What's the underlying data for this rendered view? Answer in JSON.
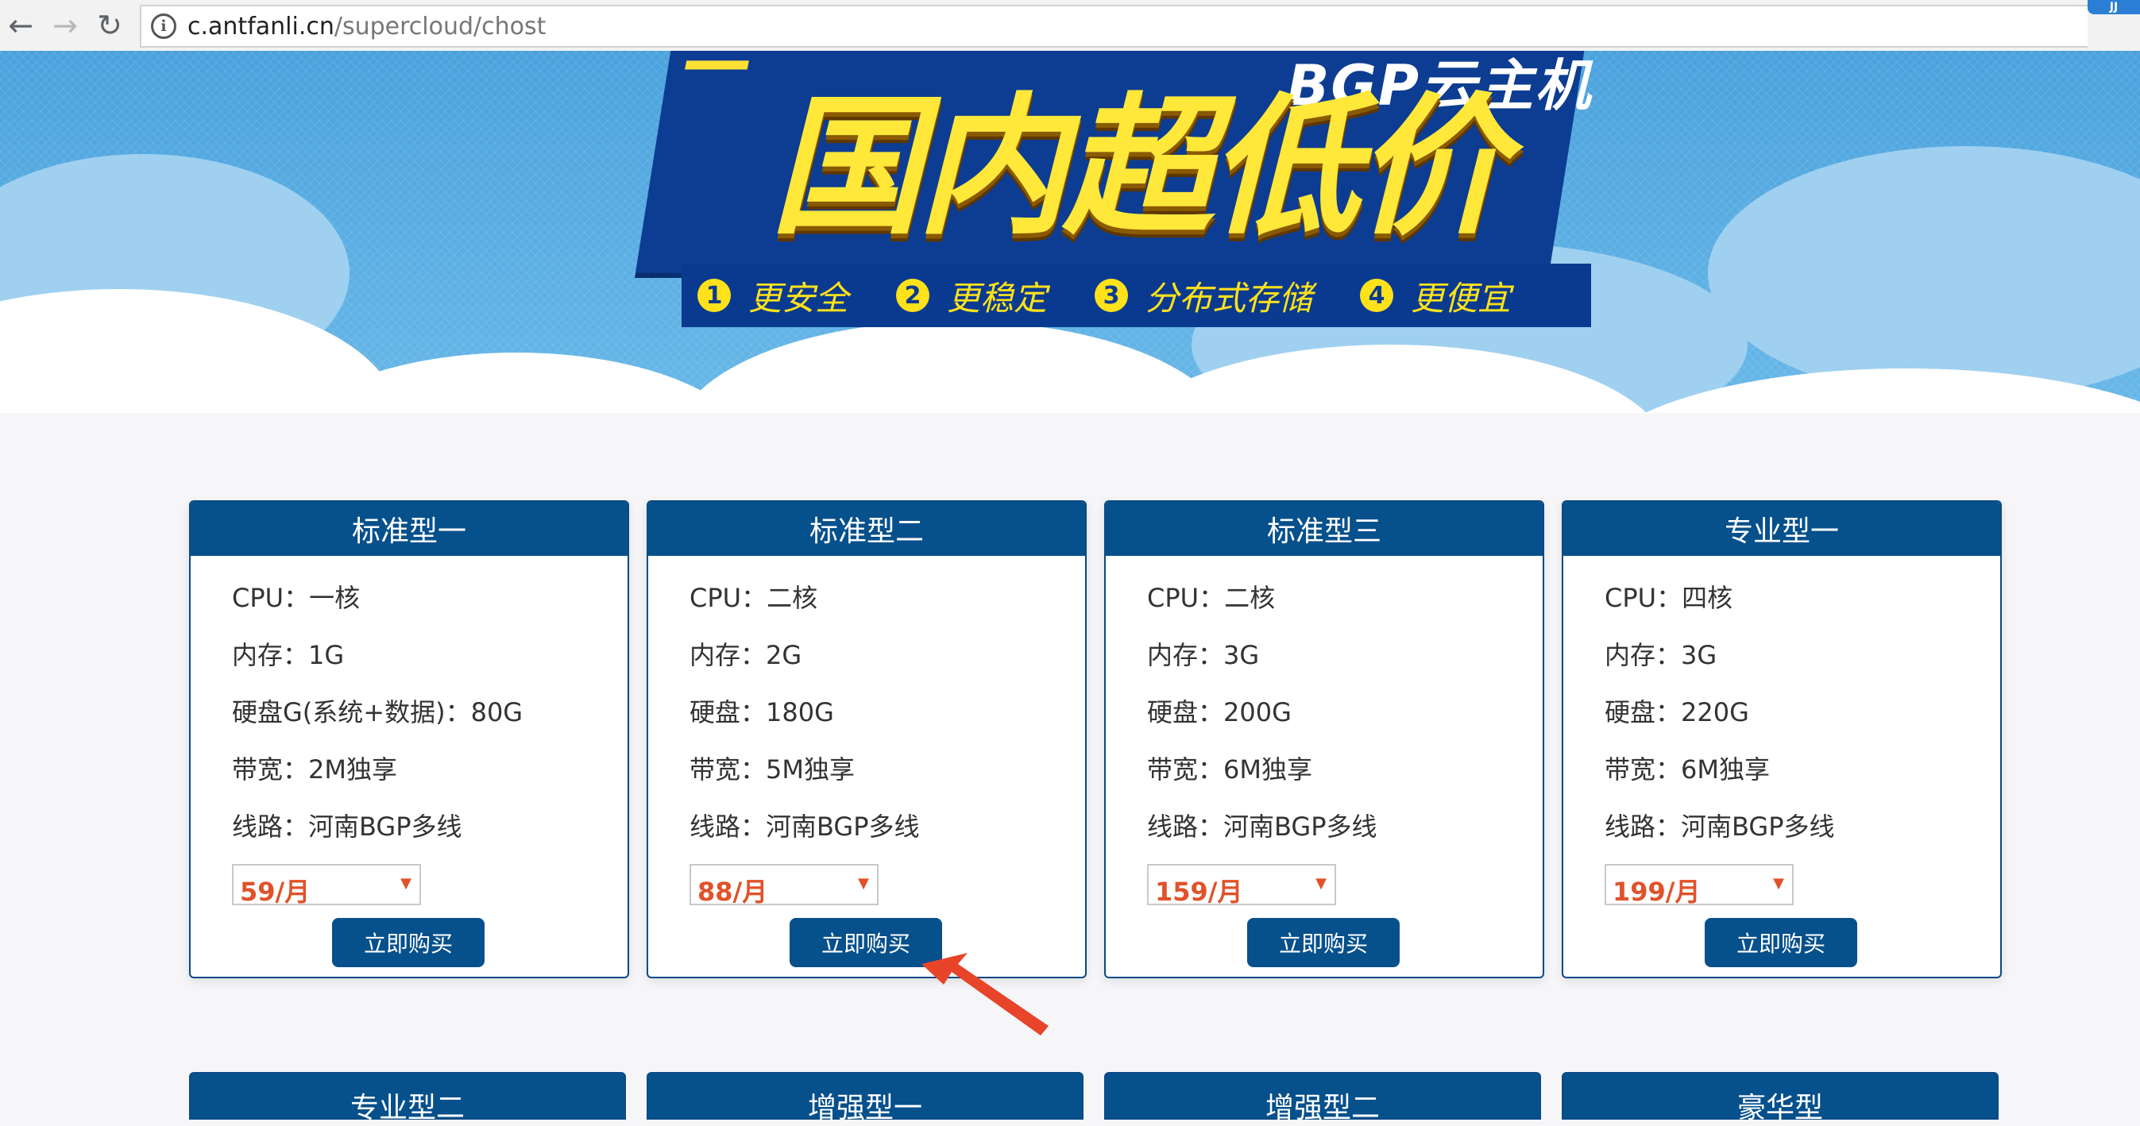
{
  "browser": {
    "url_host": "c.antfanli.cn",
    "url_path": "/supercloud/chost",
    "ext_badge": "JJ"
  },
  "banner": {
    "subtitle": "BGP云主机",
    "title": "国内超低价",
    "features": [
      {
        "num": "1",
        "label": "更安全"
      },
      {
        "num": "2",
        "label": "更稳定"
      },
      {
        "num": "3",
        "label": "分布式存储"
      },
      {
        "num": "4",
        "label": "更便宜"
      }
    ]
  },
  "plans": [
    {
      "title": "标准型一",
      "cpu": "CPU：一核",
      "memory": "内存：1G",
      "disk": "硬盘G(系统+数据)：80G",
      "bandwidth": "带宽：2M独享",
      "line": "线路：河南BGP多线",
      "price": "59/月",
      "buy": "立即购买"
    },
    {
      "title": "标准型二",
      "cpu": "CPU：二核",
      "memory": "内存：2G",
      "disk": "硬盘：180G",
      "bandwidth": "带宽：5M独享",
      "line": "线路：河南BGP多线",
      "price": "88/月",
      "buy": "立即购买"
    },
    {
      "title": "标准型三",
      "cpu": "CPU：二核",
      "memory": "内存：3G",
      "disk": "硬盘：200G",
      "bandwidth": "带宽：6M独享",
      "line": "线路：河南BGP多线",
      "price": "159/月",
      "buy": "立即购买"
    },
    {
      "title": "专业型一",
      "cpu": "CPU：四核",
      "memory": "内存：3G",
      "disk": "硬盘：220G",
      "bandwidth": "带宽：6M独享",
      "line": "线路：河南BGP多线",
      "price": "199/月",
      "buy": "立即购买"
    }
  ],
  "plans_row2": [
    "专业型二",
    "增强型一",
    "增强型二",
    "豪华型"
  ],
  "colors": {
    "primary": "#06508c",
    "price": "#e0522a",
    "banner": "#5aaee2",
    "feature": "#ffe21a"
  }
}
